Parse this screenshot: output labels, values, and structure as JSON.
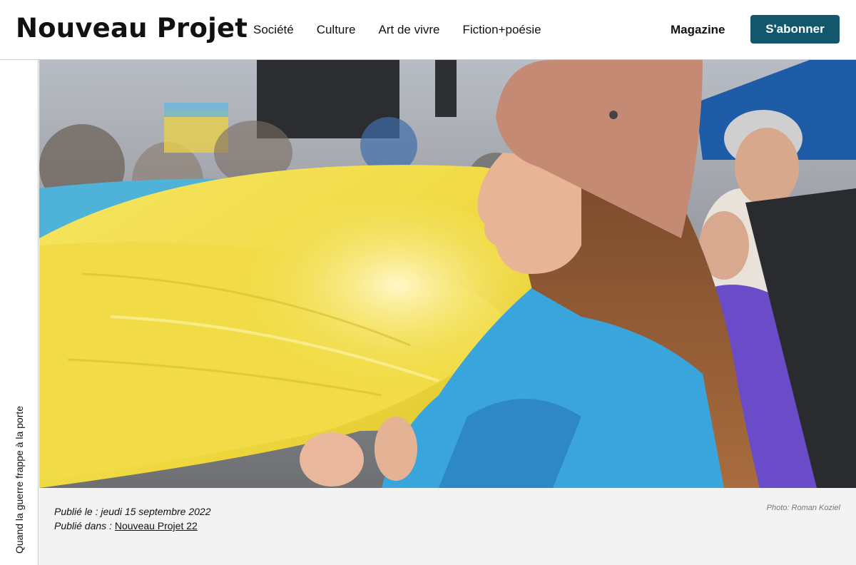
{
  "header": {
    "logo": "Nouveau Projet",
    "nav": [
      "Société",
      "Culture",
      "Art de vivre",
      "Fiction+poésie"
    ],
    "magazine_label": "Magazine",
    "subscribe_label": "S'abonner"
  },
  "rail": {
    "vertical_title": "Quand la guerre frappe à la porte"
  },
  "article": {
    "published_label": "Publié le : ",
    "published_date": "jeudi 15 septembre 2022",
    "published_in_label": "Publié dans : ",
    "published_in_link": "Nouveau Projet 22",
    "photo_credit": "Photo: Roman Koziel"
  },
  "colors": {
    "accent": "#13576c",
    "caption_bg": "#f3f3f3",
    "flag_yellow": "#f2dd4a",
    "flag_blue": "#3ab2de",
    "beanie": "#c48a74"
  }
}
